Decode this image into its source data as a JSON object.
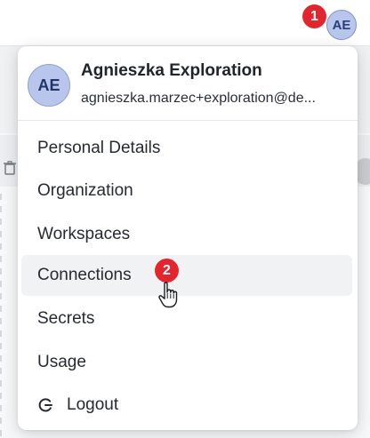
{
  "header": {
    "avatar_initials": "AE",
    "step_badge": "1"
  },
  "user_menu": {
    "avatar_initials": "AE",
    "name": "Agnieszka Exploration",
    "email": "agnieszka.marzec+exploration@de..."
  },
  "menu_items": [
    {
      "label": "Personal Details"
    },
    {
      "label": "Organization"
    },
    {
      "label": "Workspaces"
    },
    {
      "label": "Connections",
      "hovered": true
    },
    {
      "label": "Secrets"
    },
    {
      "label": "Usage"
    }
  ],
  "logout": {
    "label": "Logout",
    "icon": "logout-icon"
  },
  "annotation": {
    "step_badge": "2"
  },
  "colors": {
    "badge": "#e5252e",
    "avatar_fill": "#b7c6ea",
    "hover_row": "#f0f2f3"
  }
}
